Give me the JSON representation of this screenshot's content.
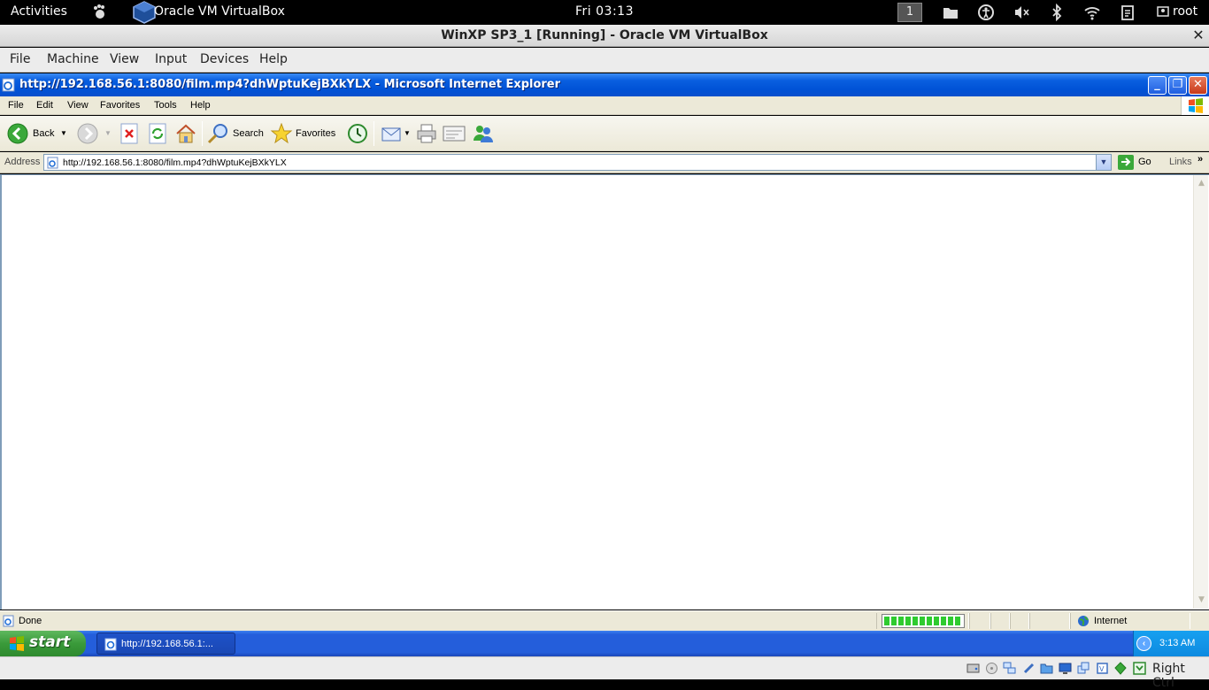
{
  "gnome": {
    "activities": "Activities",
    "app_name": "Oracle VM VirtualBox",
    "clock": "Fri 03:13",
    "workspace": "1",
    "user": "root"
  },
  "vbox": {
    "title": "WinXP SP3_1 [Running] - Oracle VM VirtualBox",
    "menu": [
      "File",
      "Machine",
      "View",
      "Input",
      "Devices",
      "Help"
    ],
    "host_key": "Right Ctrl"
  },
  "ie": {
    "title": "http://192.168.56.1:8080/film.mp4?dhWptuKejBXkYLX - Microsoft Internet Explorer",
    "menu": [
      "File",
      "Edit",
      "View",
      "Favorites",
      "Tools",
      "Help"
    ],
    "toolbar": {
      "back": "Back",
      "search": "Search",
      "favorites": "Favorites"
    },
    "address": {
      "label": "Address",
      "url": "http://192.168.56.1:8080/film.mp4?dhWptuKejBXkYLX",
      "go": "Go",
      "links": "Links"
    },
    "status": {
      "text": "Done",
      "progress_fraction": 1.0,
      "zone": "Internet"
    }
  },
  "xp": {
    "start": "start",
    "task_label": "http://192.168.56.1:...",
    "time": "3:13 AM"
  },
  "colors": {
    "xp_title_blue": "#0052d6",
    "xp_taskbar_blue": "#245edb",
    "xp_start_green": "#3a9a3a",
    "ie_chrome": "#ece9d8",
    "progress_green": "#2fcb2f"
  }
}
